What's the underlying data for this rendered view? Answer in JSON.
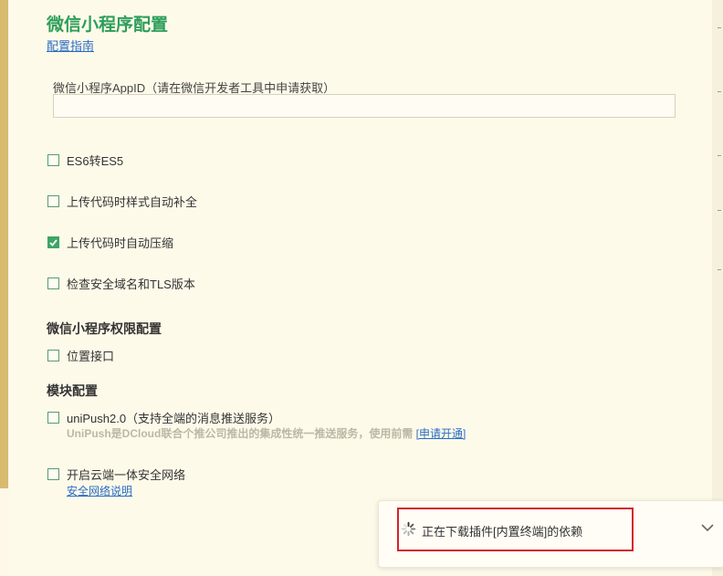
{
  "header": {
    "title": "微信小程序配置",
    "guide_link": "配置指南"
  },
  "appid": {
    "label": "微信小程序AppID（请在微信开发者工具中申请获取）",
    "value": "",
    "placeholder": ""
  },
  "options": [
    {
      "label": "ES6转ES5",
      "checked": false
    },
    {
      "label": "上传代码时样式自动补全",
      "checked": false
    },
    {
      "label": "上传代码时自动压缩",
      "checked": true
    },
    {
      "label": "检查安全域名和TLS版本",
      "checked": false
    }
  ],
  "permissions": {
    "title": "微信小程序权限配置",
    "items": [
      {
        "label": "位置接口",
        "checked": false
      }
    ]
  },
  "modules": {
    "title": "模块配置",
    "unipush": {
      "label": "uniPush2.0（支持全端的消息推送服务）",
      "checked": false,
      "desc": "UniPush是DCloud联合个推公司推出的集成性统一推送服务，使用前需",
      "link": "[申请开通]"
    },
    "security": {
      "label": "开启云端一体安全网络",
      "checked": false,
      "link": "安全网络说明"
    }
  },
  "toast": {
    "text": "正在下载插件[内置终端]的依赖",
    "icon": "spinner-icon",
    "expand_icon": "chevron-down-icon"
  },
  "colors": {
    "accent": "#2d9e5a",
    "checkbox": "#3ea565",
    "link": "#2b6cc4",
    "highlight": "#d4232b"
  }
}
